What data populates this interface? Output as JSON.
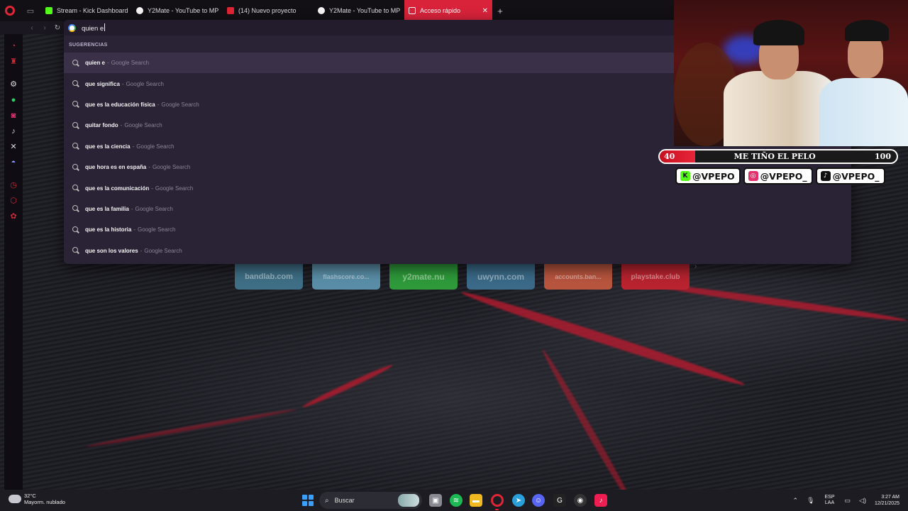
{
  "browser": {
    "tabs": [
      {
        "label": "Stream - Kick Dashboard",
        "favicon_color": "#53fc18"
      },
      {
        "label": "Y2Mate - YouTube to MP",
        "favicon_color": "#f5f5f5"
      },
      {
        "label": "(14) Nuevo proyecto",
        "favicon_color": "#e02535"
      },
      {
        "label": "Y2Mate - YouTube to MP",
        "favicon_color": "#f5f5f5"
      },
      {
        "label": "Acceso rápido",
        "favicon_color": "#ffffff",
        "active": true
      }
    ],
    "new_tab_label": "+",
    "close_tab_label": "✕",
    "accent": "#d8233a"
  },
  "omnibox": {
    "query": "quien e",
    "suggestions_header": "SUGERENCIAS",
    "suggestions": [
      {
        "text": "quien e",
        "source": "Google Search"
      },
      {
        "text": "que significa",
        "source": "Google Search"
      },
      {
        "text": "que es la educación física",
        "source": "Google Search"
      },
      {
        "text": "quitar fondo",
        "source": "Google Search"
      },
      {
        "text": "que es la ciencia",
        "source": "Google Search"
      },
      {
        "text": "que hora es en españa",
        "source": "Google Search"
      },
      {
        "text": "que es la comunicación",
        "source": "Google Search"
      },
      {
        "text": "que es la familia",
        "source": "Google Search"
      },
      {
        "text": "que es la historia",
        "source": "Google Search"
      },
      {
        "text": "que son los valores",
        "source": "Google Search"
      }
    ],
    "separator": "-"
  },
  "speed_dials": [
    {
      "label": "bandlab.com",
      "color": "#3f6f86"
    },
    {
      "label": "flashscore.co...",
      "color": "#5a8ea8"
    },
    {
      "label": "y2mate.nu",
      "color": "#2e9a3a"
    },
    {
      "label": "uwynn.com",
      "color": "#3a6a88"
    },
    {
      "label": "accounts.ban...",
      "color": "#b8553f"
    },
    {
      "label": "playstake.club",
      "color": "#b8232f"
    }
  ],
  "stream_overlay": {
    "goal": {
      "start": "40",
      "title": "ME TIÑO EL PELO",
      "end": "100",
      "progress": 0.15
    },
    "socials": [
      {
        "handle": "@VPEPO",
        "icon": "kick-icon",
        "color": "#53fc18",
        "glyph": "K"
      },
      {
        "handle": "@VPEPO_",
        "icon": "instagram-icon",
        "color": "#e1306c",
        "glyph": "◎"
      },
      {
        "handle": "@VPEPO_",
        "icon": "tiktok-icon",
        "color": "#111111",
        "glyph": "♪"
      }
    ]
  },
  "taskbar": {
    "weather_temp": "32°C",
    "weather_desc": "Mayorm. nublado",
    "search_placeholder": "Buscar",
    "lang_line1": "ESP",
    "lang_line2": "LAA",
    "time": "3:27 AM",
    "date": "12/21/2025"
  }
}
